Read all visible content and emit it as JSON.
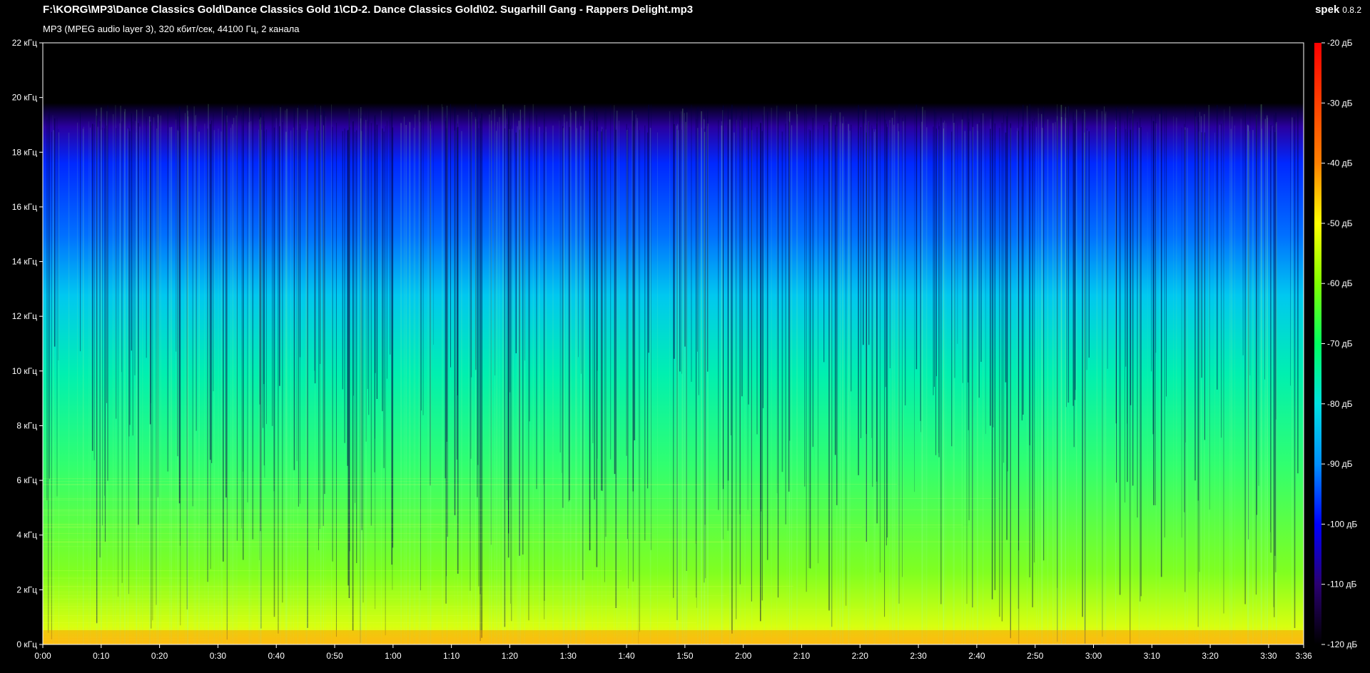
{
  "header": {
    "file_path": "F:\\KORG\\MP3\\Dance Classics Gold\\Dance Classics Gold 1\\CD-2. Dance Classics Gold\\02. Sugarhill Gang - Rappers Delight.mp3",
    "file_info": "MP3 (MPEG audio layer 3), 320 кбит/сек, 44100 Гц, 2 канала",
    "app_name": "spek",
    "app_version": "0.8.2"
  },
  "colors": {
    "background": "#000000",
    "frame": "#ffffff",
    "palette": [
      "#000000",
      "#1a0066",
      "#0000ff",
      "#0090ff",
      "#00e0e0",
      "#00ff60",
      "#80ff00",
      "#ffff00",
      "#ff8000",
      "#ff0000"
    ]
  },
  "chart_data": {
    "type": "heatmap",
    "title": "",
    "xlabel": "",
    "ylabel": "",
    "x_ticks": [
      "0:00",
      "0:10",
      "0:20",
      "0:30",
      "0:40",
      "0:50",
      "1:00",
      "1:10",
      "1:20",
      "1:30",
      "1:40",
      "1:50",
      "2:00",
      "2:10",
      "2:20",
      "2:30",
      "2:40",
      "2:50",
      "3:00",
      "3:10",
      "3:20",
      "3:30",
      "3:36"
    ],
    "x_tick_seconds": [
      0,
      10,
      20,
      30,
      40,
      50,
      60,
      70,
      80,
      90,
      100,
      110,
      120,
      130,
      140,
      150,
      160,
      170,
      180,
      190,
      200,
      210,
      216
    ],
    "xlim_seconds": [
      0,
      216
    ],
    "y_ticks": [
      "0 кГц",
      "2 кГц",
      "4 кГц",
      "6 кГц",
      "8 кГц",
      "10 кГц",
      "12 кГц",
      "14 кГц",
      "16 кГц",
      "18 кГц",
      "20 кГц",
      "22 кГц"
    ],
    "y_tick_khz": [
      0,
      2,
      4,
      6,
      8,
      10,
      12,
      14,
      16,
      18,
      20,
      22
    ],
    "ylim_khz": [
      0,
      22
    ],
    "cutoff_khz": 19.5,
    "colorbar_ticks": [
      "-20 дБ",
      "-30 дБ",
      "-40 дБ",
      "-50 дБ",
      "-60 дБ",
      "-70 дБ",
      "-80 дБ",
      "-90 дБ",
      "-100 дБ",
      "-110 дБ",
      "-120 дБ"
    ],
    "colorbar_db": [
      -20,
      -30,
      -40,
      -50,
      -60,
      -70,
      -80,
      -90,
      -100,
      -110,
      -120
    ],
    "colorbar_range_db": [
      -120,
      -20
    ]
  }
}
